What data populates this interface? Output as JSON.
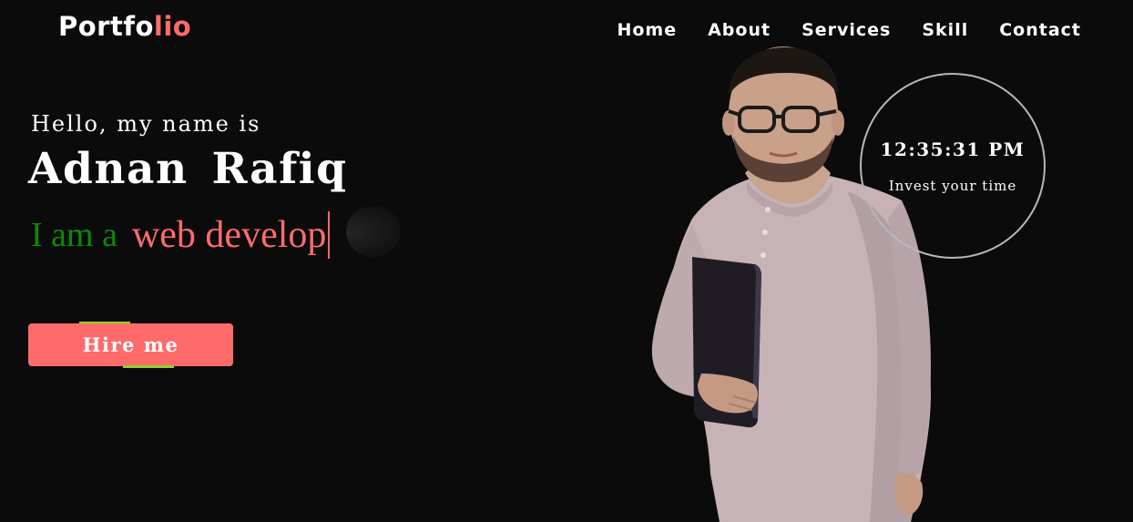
{
  "logo": {
    "main": "Portfo",
    "accent": "lio"
  },
  "nav": {
    "items": [
      "Home",
      "About",
      "Services",
      "Skill",
      "Contact"
    ]
  },
  "hero": {
    "greeting": "Hello, my name is",
    "name": "Adnan Rafiq",
    "role_prefix": "I am a",
    "role_typed": "web develop",
    "hire_label": "Hire me"
  },
  "clock": {
    "time": "12:35:31 PM",
    "caption": "Invest your time"
  },
  "colors": {
    "background": "#0b0b0b",
    "accent": "#ff6b6b",
    "role_prefix": "#0a8a0a",
    "button_edge": "#8bd42a",
    "clock_ring": "#b8b8b8"
  },
  "icons": {
    "person": "person-photo"
  }
}
